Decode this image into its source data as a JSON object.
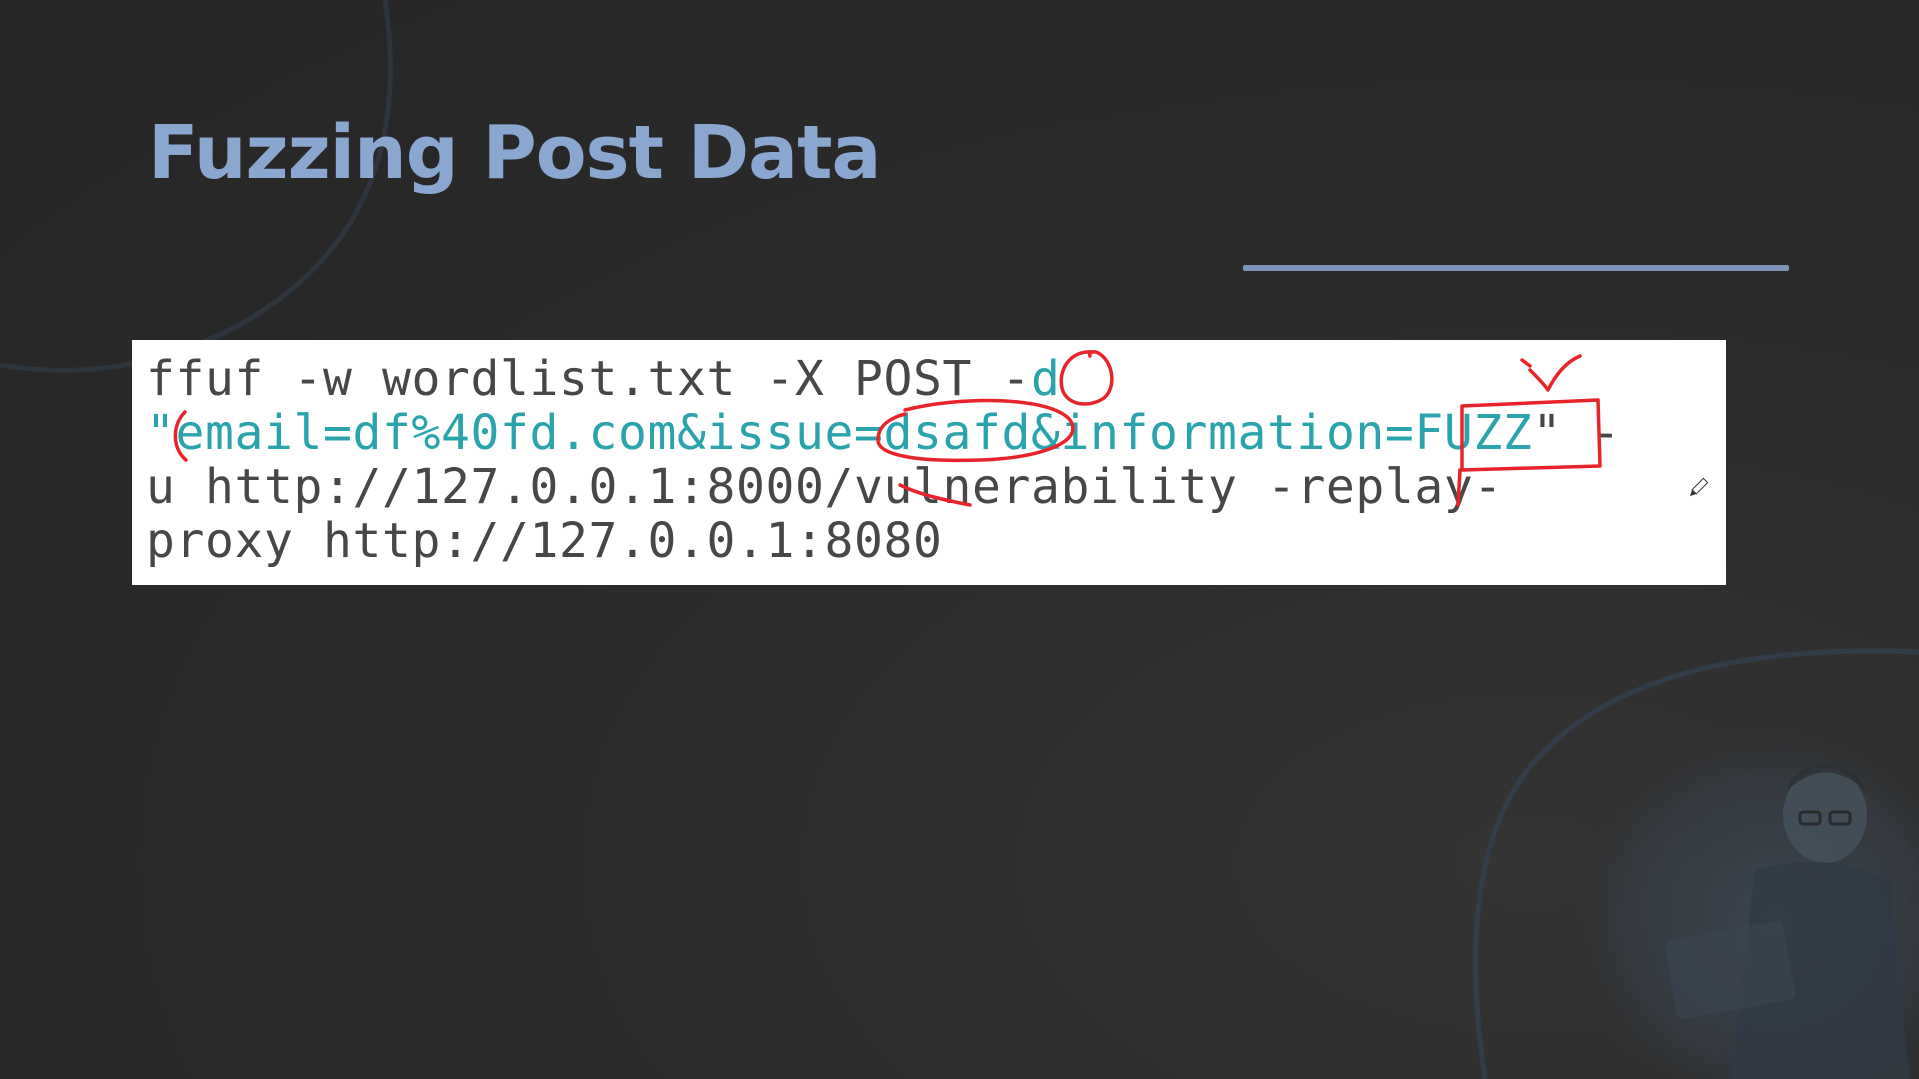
{
  "slide": {
    "title": "Fuzzing Post Data"
  },
  "command": {
    "line1_plain": "ffuf -w wordlist.txt -X POST -",
    "line1_flag": "d",
    "line2_quote_open": "\"",
    "line2_data": "email=df%40fd.com&issue=dsafd&information=FUZZ",
    "line2_tail": "\" -",
    "line3": "u http://127.0.0.1:8000/vulnerability -replay-",
    "line4": "proxy http://127.0.0.1:8080"
  },
  "colors": {
    "background": "#2b2b2b",
    "title": "#8aa7cf",
    "underline": "#7c93b9",
    "code_text": "#474747",
    "code_highlight": "#2aa3ad",
    "annotation": "#e8242a"
  },
  "icons": {
    "cursor": "pen-cursor-icon"
  }
}
